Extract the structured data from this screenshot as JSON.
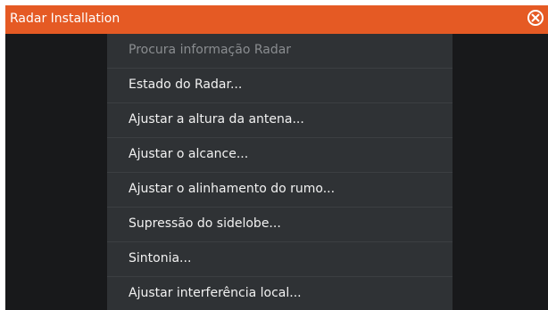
{
  "dialog": {
    "title": "Radar Installation",
    "close_icon": "close-circle-icon"
  },
  "menu": {
    "items": [
      {
        "label": "Procura informação Radar",
        "enabled": false
      },
      {
        "label": "Estado do Radar...",
        "enabled": true
      },
      {
        "label": "Ajustar a altura da antena...",
        "enabled": true
      },
      {
        "label": "Ajustar o alcance...",
        "enabled": true
      },
      {
        "label": "Ajustar o alinhamento do rumo...",
        "enabled": true
      },
      {
        "label": "Supressão do  sidelobe...",
        "enabled": true
      },
      {
        "label": "Sintonia...",
        "enabled": true
      },
      {
        "label": "Ajustar interferência local...",
        "enabled": true
      }
    ]
  },
  "colors": {
    "title_bar": "#e55a24",
    "background": "#18191b",
    "menu_panel": "#2f3235",
    "text": "#f2f2f2",
    "disabled_text": "#8a8d90"
  }
}
